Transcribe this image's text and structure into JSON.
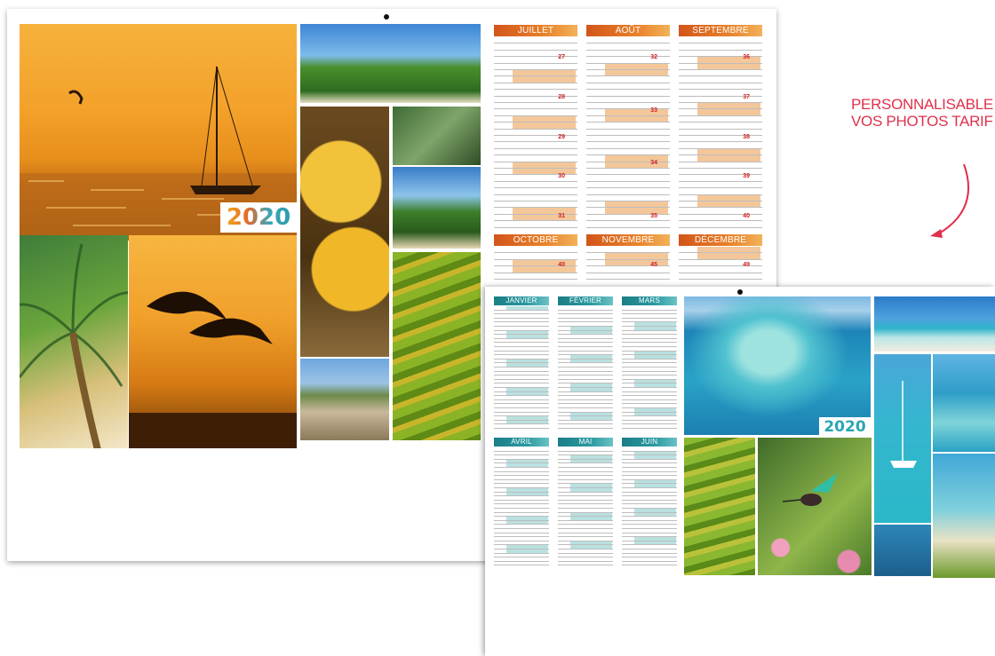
{
  "promo": {
    "line1": "PERSONNALISABLE",
    "line2": "VOS PHOTOS TARIF"
  },
  "back_calendar": {
    "year": "2020",
    "months": [
      "JUILLET",
      "AOÛT",
      "SEPTEMBRE",
      "OCTOBRE",
      "NOVEMBRE",
      "DÉCEMBRE"
    ],
    "week_numbers": [
      [
        "27",
        "28",
        "29",
        "30",
        "31"
      ],
      [
        "32",
        "33",
        "34",
        "35"
      ],
      [
        "36",
        "37",
        "38",
        "39",
        "40"
      ],
      [
        "40"
      ],
      [
        "45"
      ],
      [
        "49"
      ]
    ]
  },
  "front_calendar": {
    "year": "2020",
    "months": [
      "JANVIER",
      "FÉVRIER",
      "MARS",
      "AVRIL",
      "MAI",
      "JUIN"
    ]
  },
  "colors": {
    "promo": "#e0304c",
    "back_month_header": "#e07a28",
    "front_month_header": "#2a9aa1",
    "year_orange": "#ef8a1e",
    "year_teal": "#2aa6b0"
  }
}
